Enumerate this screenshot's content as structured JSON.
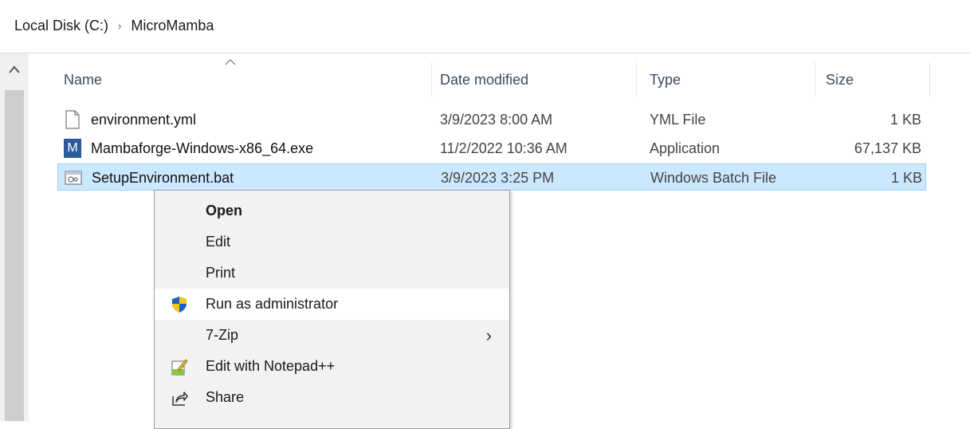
{
  "breadcrumb": {
    "items": [
      "Local Disk (C:)",
      "MicroMamba"
    ],
    "separator": "›"
  },
  "columns": {
    "name": "Name",
    "date": "Date modified",
    "type": "Type",
    "size": "Size"
  },
  "files": [
    {
      "name": "environment.yml",
      "date": "3/9/2023 8:00 AM",
      "type": "YML File",
      "size": "1 KB",
      "icon": "text-file-icon"
    },
    {
      "name": "Mambaforge-Windows-x86_64.exe",
      "date": "11/2/2022 10:36 AM",
      "type": "Application",
      "size": "67,137 KB",
      "icon": "mamba-app-icon",
      "icon_letter": "M"
    },
    {
      "name": "SetupEnvironment.bat",
      "date": "3/9/2023 3:25 PM",
      "type": "Windows Batch File",
      "size": "1 KB",
      "icon": "batch-file-icon",
      "selected": true
    }
  ],
  "context_menu": {
    "items": [
      {
        "label": "Open",
        "default": true
      },
      {
        "label": "Edit"
      },
      {
        "label": "Print"
      },
      {
        "label": "Run as administrator",
        "icon": "uac-shield-icon",
        "hover": true
      },
      {
        "label": "7-Zip",
        "submenu_arrow": "›"
      },
      {
        "label": "Edit with Notepad++",
        "icon": "notepad-plus-plus-icon"
      },
      {
        "label": "Share",
        "icon": "share-icon"
      }
    ]
  },
  "colors": {
    "selection": "#cce8ff",
    "selection_border": "#99d1ff",
    "header_text": "#3b4a66",
    "menu_bg": "#f2f2f2"
  }
}
